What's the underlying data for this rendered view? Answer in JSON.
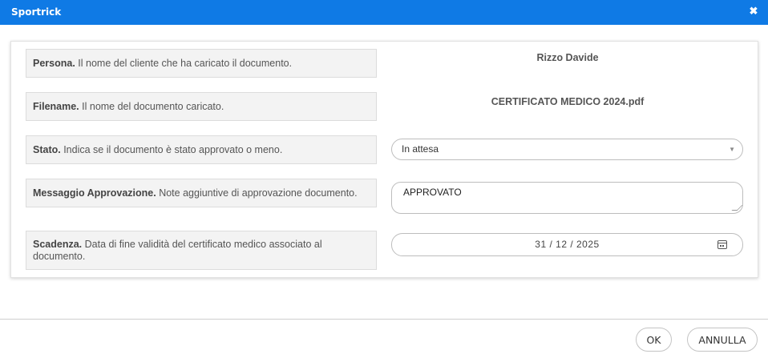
{
  "window": {
    "title": "Sportrick",
    "close_icon": "close-icon",
    "title_bar_color": "#0f7ae5"
  },
  "form": {
    "rows": [
      {
        "label_bold": "Persona.",
        "label_desc": " Il nome del cliente che ha caricato il documento.",
        "value": "Rizzo Davide"
      },
      {
        "label_bold": "Filename.",
        "label_desc": " Il nome del documento caricato.",
        "value": "CERTIFICATO MEDICO 2024.pdf"
      },
      {
        "label_bold": "Stato.",
        "label_desc": " Indica se il documento è stato approvato o meno."
      },
      {
        "label_bold": "Messaggio Approvazione.",
        "label_desc": " Note aggiuntive di approvazione documento."
      },
      {
        "label_bold": "Scadenza.",
        "label_desc": " Data di fine validità del certificato medico associato al documento."
      }
    ],
    "stato_select": {
      "value": "In attesa",
      "arrow_icon": "triangle-down-icon"
    },
    "messaggio_textarea": {
      "value": "APPROVATO"
    },
    "scadenza_date": {
      "value": "31 / 12 / 2025",
      "calendar_icon": "calendar-icon"
    }
  },
  "footer": {
    "ok_label": "OK",
    "cancel_label": "ANNULLA"
  }
}
